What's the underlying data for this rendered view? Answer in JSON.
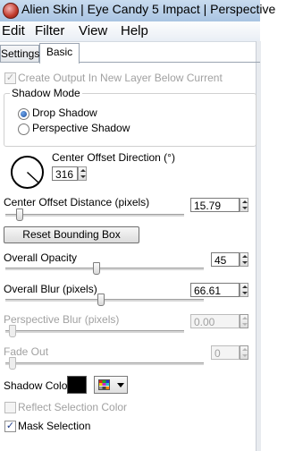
{
  "window": {
    "title": "Alien Skin | Eye Candy 5 Impact | Perspective"
  },
  "menu": [
    "Edit",
    "Filter",
    "View",
    "Help"
  ],
  "tabs": [
    {
      "label": "Settings",
      "active": false
    },
    {
      "label": "Basic",
      "active": true
    }
  ],
  "create_output": {
    "label": "Create Output In New Layer Below Current",
    "checked": true,
    "enabled": false
  },
  "shadow_mode": {
    "label": "Shadow Mode",
    "options": [
      "Drop Shadow",
      "Perspective Shadow"
    ],
    "selected": "Drop Shadow"
  },
  "center_offset_direction": {
    "label": "Center Offset Direction (°)",
    "value": "316"
  },
  "center_offset_distance": {
    "label": "Center Offset Distance (pixels)",
    "value": "15.79",
    "slider_fraction": 0.06
  },
  "reset_button": {
    "label": "Reset Bounding Box"
  },
  "overall_opacity": {
    "label": "Overall Opacity",
    "value": "45",
    "slider_fraction": 0.45
  },
  "overall_blur": {
    "label": "Overall Blur (pixels)",
    "value": "66.61",
    "slider_fraction": 0.47
  },
  "perspective_blur": {
    "label": "Perspective Blur (pixels)",
    "value": "0.00",
    "enabled": false
  },
  "fade_out": {
    "label": "Fade Out",
    "value": "0",
    "enabled": false
  },
  "shadow_color": {
    "label": "Shadow Color",
    "color": "#000000"
  },
  "reflect_selection_color": {
    "label": "Reflect Selection Color",
    "checked": false,
    "enabled": false
  },
  "mask_selection": {
    "label": "Mask Selection",
    "checked": true
  }
}
